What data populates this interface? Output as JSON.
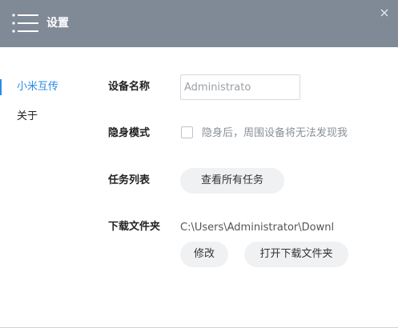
{
  "titlebar": {
    "title": "设置",
    "menu_icon": "menu-icon",
    "close_icon": "close-icon",
    "background": "#7f8a96"
  },
  "sidebar": {
    "items": [
      {
        "label": "小米互传",
        "active": true
      },
      {
        "label": "关于",
        "active": false
      }
    ],
    "accent": "#2a8ce8"
  },
  "settings": {
    "device_name": {
      "label": "设备名称",
      "value": "Administrato"
    },
    "stealth_mode": {
      "label": "隐身模式",
      "checkbox_label": "隐身后，周围设备将无法发现我",
      "checked": false
    },
    "task_list": {
      "label": "任务列表",
      "button_label": "查看所有任务"
    },
    "download_folder": {
      "label": "下载文件夹",
      "path": "C:\\Users\\Administrator\\Downl",
      "modify_label": "修改",
      "open_label": "打开下载文件夹"
    }
  }
}
